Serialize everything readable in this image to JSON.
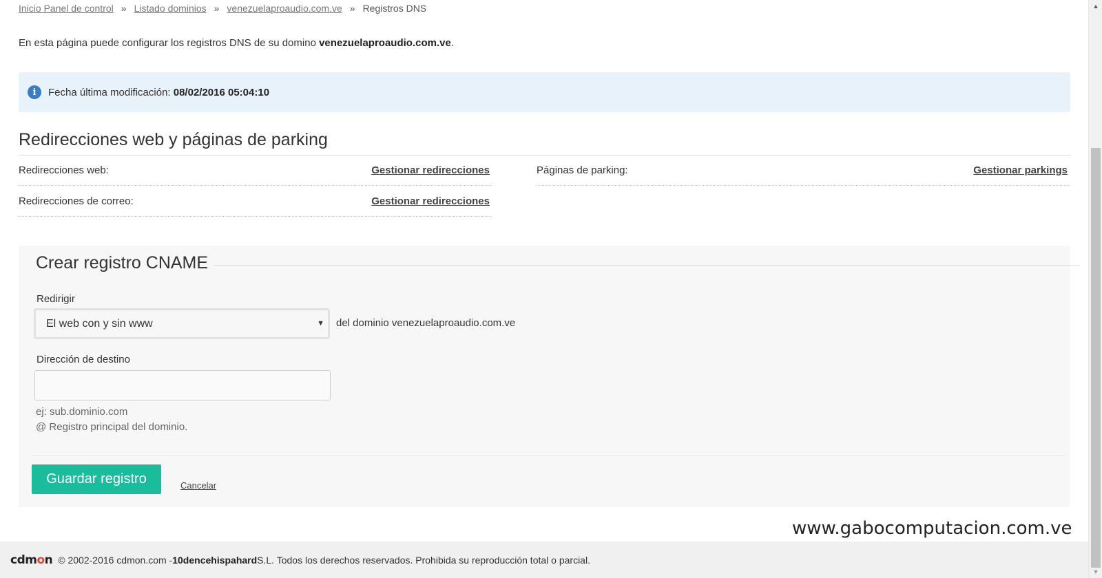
{
  "breadcrumb": {
    "items": [
      "Inicio Panel de control",
      "Listado dominios",
      "venezuelaproaudio.com.ve"
    ],
    "current": "Registros DNS",
    "separator": "»"
  },
  "intro": {
    "text": "En esta página puede configurar los registros DNS de su domino ",
    "domain": "venezuelaproaudio.com.ve",
    "end": "."
  },
  "info": {
    "icon": "info-icon",
    "label": "Fecha última modificación: ",
    "value": "08/02/2016 05:04:10"
  },
  "redirects": {
    "title": "Redirecciones web y páginas de parking",
    "web_label": "Redirecciones web:",
    "web_link": "Gestionar redirecciones",
    "mail_label": "Redirecciones de correo:",
    "mail_link": "Gestionar redirecciones",
    "parking_label": "Páginas de parking:",
    "parking_link": "Gestionar parkings"
  },
  "form": {
    "title": "Crear registro CNAME",
    "redirect_label": "Redirigir",
    "redirect_value": "El web con y sin www",
    "redirect_suffix": "del dominio venezuelaproaudio.com.ve",
    "dest_label": "Dirección de destino",
    "dest_value": "",
    "help_example": "ej: sub.dominio.com",
    "help_root": "@ Registro principal del dominio.",
    "save_label": "Guardar registro",
    "cancel_label": "Cancelar",
    "accent_color": "#1abc9c"
  },
  "watermark": "www.gabocomputacion.com.ve",
  "footer": {
    "logo_a": "cdm",
    "logo_o": "o",
    "logo_b": "n",
    "copyright": "© 2002-2016 cdmon.com - ",
    "company": "10dencehispahard",
    "rest": " S.L. Todos los derechos reservados. Prohibida su reproducción total o parcial."
  }
}
